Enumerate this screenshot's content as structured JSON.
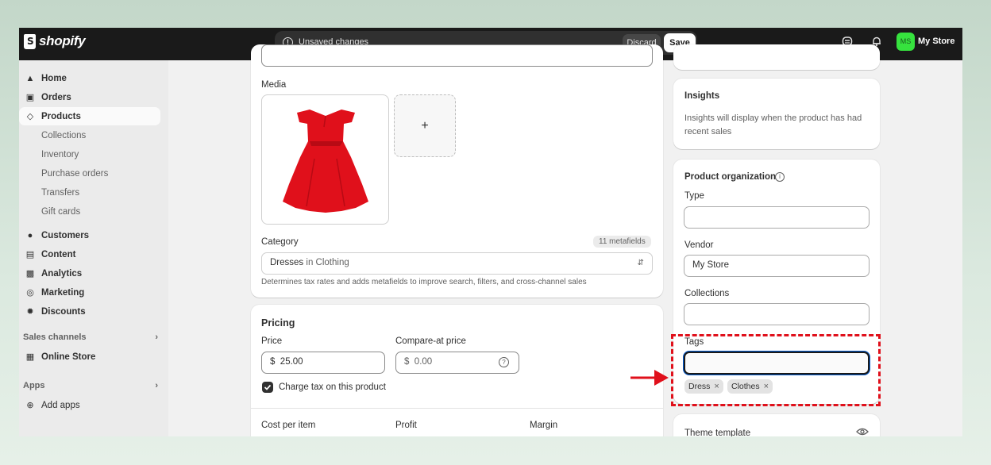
{
  "topbar": {
    "brand": "shopify",
    "unsaved_text": "Unsaved changes",
    "discard_label": "Discard",
    "save_label": "Save",
    "store_initials": "MS",
    "store_name": "My Store"
  },
  "sidebar": {
    "items": [
      {
        "label": "Home",
        "icon": "home-icon"
      },
      {
        "label": "Orders",
        "icon": "inbox-icon"
      },
      {
        "label": "Products",
        "icon": "tag-icon"
      },
      {
        "label": "Collections"
      },
      {
        "label": "Inventory"
      },
      {
        "label": "Purchase orders"
      },
      {
        "label": "Transfers"
      },
      {
        "label": "Gift cards"
      },
      {
        "label": "Customers",
        "icon": "person-icon"
      },
      {
        "label": "Content",
        "icon": "content-icon"
      },
      {
        "label": "Analytics",
        "icon": "bar-chart-icon"
      },
      {
        "label": "Marketing",
        "icon": "target-icon"
      },
      {
        "label": "Discounts",
        "icon": "discount-icon"
      },
      {
        "label": "Online Store",
        "icon": "store-icon"
      },
      {
        "label": "Add apps",
        "icon": "plus-circle-icon"
      }
    ],
    "sales_channels": "Sales channels",
    "apps": "Apps"
  },
  "media": {
    "label": "Media",
    "add_glyph": "+"
  },
  "category": {
    "label": "Category",
    "metafields_badge": "11 metafields",
    "value_main": "Dresses",
    "value_rest": "in Clothing",
    "help": "Determines tax rates and adds metafields to improve search, filters, and cross-channel sales"
  },
  "pricing": {
    "title": "Pricing",
    "price_label": "Price",
    "currency": "$",
    "price_value": "25.00",
    "compare_label": "Compare-at price",
    "compare_placeholder": "0.00",
    "charge_tax": "Charge tax on this product",
    "cost_label": "Cost per item",
    "profit_label": "Profit",
    "margin_label": "Margin"
  },
  "insights": {
    "title": "Insights",
    "text": "Insights will display when the product has had recent sales"
  },
  "organization": {
    "title": "Product organization",
    "type_label": "Type",
    "type_value": "",
    "vendor_label": "Vendor",
    "vendor_value": "My Store",
    "collections_label": "Collections",
    "collections_value": "",
    "tags_label": "Tags",
    "tags": [
      "Dress",
      "Clothes"
    ]
  },
  "theme": {
    "title": "Theme template"
  },
  "colors": {
    "highlight_red": "#e0101b",
    "store_badge": "#36e23e",
    "focus_blue": "#005bd3"
  }
}
